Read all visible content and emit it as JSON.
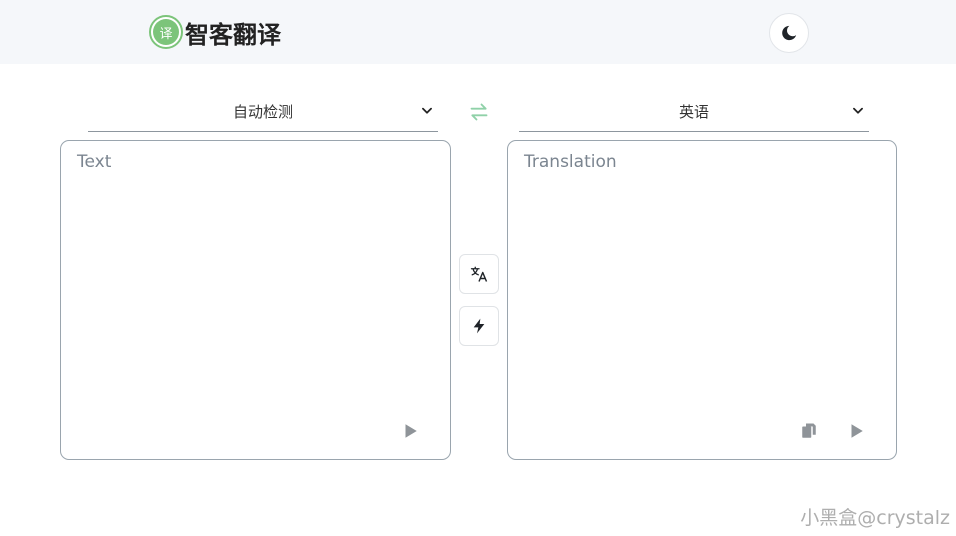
{
  "header": {
    "logo_glyph": "译",
    "app_name": "智客翻译",
    "theme_toggle_icon": "moon-icon"
  },
  "source_lang": {
    "selected": "自动检测",
    "icon": "chevron-down-icon"
  },
  "target_lang": {
    "selected": "英语",
    "icon": "chevron-down-icon"
  },
  "swap": {
    "icon": "swap-arrows-icon",
    "color": "#8fd1a8"
  },
  "source_panel": {
    "placeholder": "Text",
    "value": "",
    "play_icon": "play-icon"
  },
  "target_panel": {
    "placeholder": "Translation",
    "value": "",
    "copy_icon": "copy-icon",
    "play_icon": "play-icon"
  },
  "actions": {
    "translate_icon": "translate-icon",
    "quick_icon": "lightning-icon"
  },
  "watermark": "小黑盒@crystalz",
  "colors": {
    "accent": "#7cc47a",
    "header_bg": "#f5f7fa",
    "border": "#9aa5ae"
  }
}
